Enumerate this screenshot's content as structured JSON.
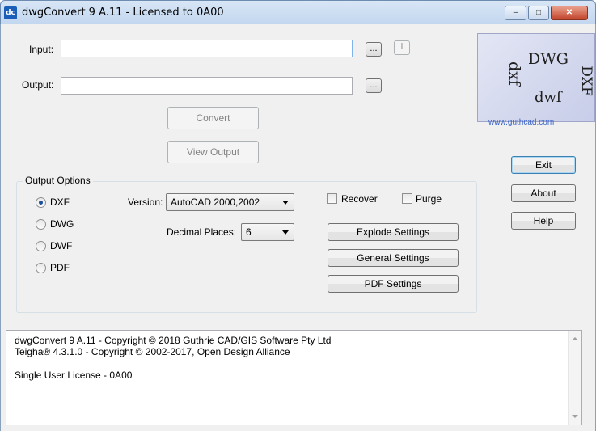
{
  "window": {
    "app_icon": "dc",
    "title": "dwgConvert 9 A.11 - Licensed to 0A00",
    "minimize_glyph": "–",
    "maximize_glyph": "□",
    "close_glyph": "✕"
  },
  "form": {
    "input_label": "Input:",
    "input_value": "",
    "browse_input_label": "...",
    "info_label": "i",
    "output_label": "Output:",
    "output_value": "",
    "browse_output_label": "...",
    "convert_label": "Convert",
    "view_output_label": "View Output"
  },
  "logo": {
    "dwg": "DWG",
    "dxf_left": "dxf",
    "dxf_right": "DXF",
    "dwf": "dwf",
    "url": "www.guthcad.com"
  },
  "side_buttons": {
    "exit": "Exit",
    "about": "About",
    "help": "Help"
  },
  "output_options": {
    "legend": "Output Options",
    "formats": [
      {
        "label": "DXF",
        "checked": true
      },
      {
        "label": "DWG",
        "checked": false
      },
      {
        "label": "DWF",
        "checked": false
      },
      {
        "label": "PDF",
        "checked": false
      }
    ],
    "version_label": "Version:",
    "version_value": "AutoCAD 2000,2002",
    "decimal_label": "Decimal Places:",
    "decimal_value": "6",
    "recover_label": "Recover",
    "purge_label": "Purge",
    "explode_settings": "Explode Settings",
    "general_settings": "General Settings",
    "pdf_settings": "PDF Settings"
  },
  "info": {
    "line1": "dwgConvert 9 A.11 - Copyright © 2018 Guthrie CAD/GIS Software Pty Ltd",
    "line2": "Teigha® 4.3.1.0 - Copyright © 2002-2017, Open Design Alliance",
    "line3": "Single User License - 0A00"
  },
  "colors": {
    "accent": "#3c7fb1",
    "radio_dot": "#1a4f9c",
    "titlebar": "#c2d6ef"
  }
}
